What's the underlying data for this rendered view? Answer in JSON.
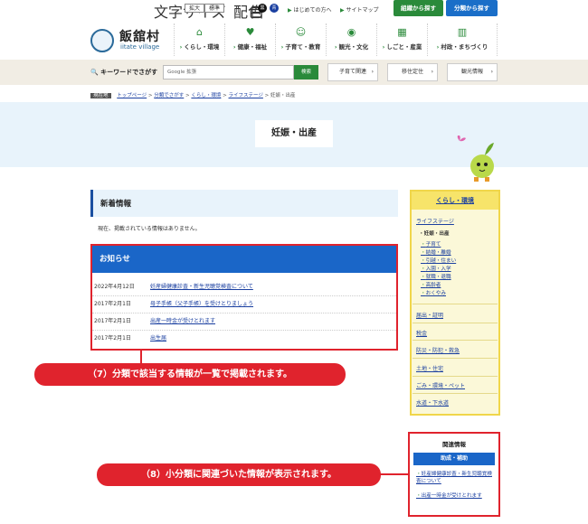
{
  "util": {
    "font_label": "文字サイズ",
    "font_large": "拡大",
    "font_std": "標準",
    "color_label": "配色",
    "c_white": "白",
    "c_black": "黒",
    "c_blue": "青",
    "first": "はじめての方へ",
    "sitemap": "サイトマップ",
    "org": "組織から探す",
    "cat": "分類から探す"
  },
  "header": {
    "logo_title": "飯舘村",
    "logo_sub": "iitate village"
  },
  "nav": [
    "くらし・環境",
    "健康・福祉",
    "子育て・教育",
    "観光・文化",
    "しごと・産業",
    "村政・まちづくり"
  ],
  "search": {
    "label": "キーワードでさがす",
    "placeholder": "Google 拡張",
    "button": "検索"
  },
  "quick": [
    "子育て関連",
    "移住定住",
    "観光情報"
  ],
  "breadcrumb": {
    "here": "現在地",
    "items": [
      "トップページ",
      "分類でさがす",
      "くらし・環境",
      "ライフステージ"
    ],
    "current": "妊娠・出産"
  },
  "page_title": "妊娠・出産",
  "new_info": {
    "title": "新着情報",
    "empty": "現在、掲載されている情報はありません。"
  },
  "notice": {
    "title": "お知らせ",
    "rows": [
      {
        "date": "2022年4月12日",
        "text": "妊産婦健康診査・新生児聴覚検査について"
      },
      {
        "date": "2017年2月1日",
        "text": "母子手帳（父子手帳）を受けとりましょう"
      },
      {
        "date": "2017年2月1日",
        "text": "出産一時金が受けとれます"
      },
      {
        "date": "2017年2月1日",
        "text": "出生届"
      }
    ]
  },
  "callout7": "（7）分類で該当する情報が一覧で掲載されます。",
  "sidebar": {
    "head": "くらし・環境",
    "stage": "ライフステージ",
    "current": "妊娠・出産",
    "subs": [
      "子育て",
      "結婚・離婚",
      "引越・住まい",
      "入園・入学",
      "就職・退職",
      "高齢者",
      "おくやみ"
    ],
    "cats": [
      "届出・証明",
      "税金",
      "防災・防犯・救急",
      "土地・住宅",
      "ごみ・環境・ペット",
      "水道・下水道"
    ]
  },
  "related": {
    "title": "関連情報",
    "sub": "助成・補助",
    "links": [
      "妊産婦健康診査・新生児聴覚検査について",
      "出産一時金が受けとれます"
    ]
  },
  "callout8": "（8）小分類に関連づいた情報が表示されます。",
  "colors": {
    "accent": "#e0232d",
    "brand_green": "#2a8a3a",
    "brand_blue": "#1a66c8"
  }
}
